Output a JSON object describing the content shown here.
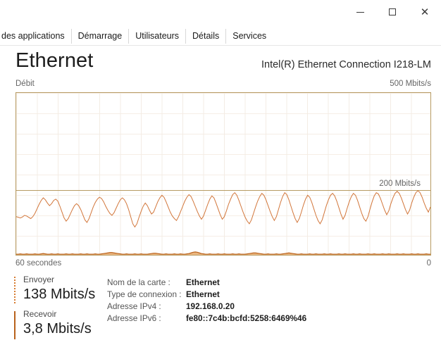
{
  "window": {
    "controls": [
      {
        "name": "minimize",
        "glyph": "minimize-icon"
      },
      {
        "name": "maximize",
        "glyph": "maximize-icon"
      },
      {
        "name": "close",
        "glyph": "close-icon",
        "label": "✕"
      }
    ]
  },
  "tabs": [
    {
      "label": "des applications",
      "clipped": true
    },
    {
      "label": "Démarrage",
      "clipped": false
    },
    {
      "label": "Utilisateurs",
      "clipped": false
    },
    {
      "label": "Détails",
      "clipped": false
    },
    {
      "label": "Services",
      "clipped": false
    }
  ],
  "header": {
    "title": "Ethernet",
    "adapter": "Intel(R) Ethernet Connection I218-LM"
  },
  "graph": {
    "caption": "Débit",
    "scale_max": "500 Mbits/s",
    "marker_label": "200 Mbits/s",
    "axis_left": "60 secondes",
    "axis_right": "0",
    "color_send": "#d2763a",
    "color_recv": "#b9621c",
    "color_border": "#b79b63"
  },
  "legend": {
    "send": {
      "label": "Envoyer",
      "value": "138 Mbits/s"
    },
    "recv": {
      "label": "Recevoir",
      "value": "3,8 Mbits/s"
    }
  },
  "details": [
    {
      "key": "Nom de la carte :",
      "value": "Ethernet"
    },
    {
      "key": "Type de connexion :",
      "value": "Ethernet"
    },
    {
      "key": "Adresse IPv4 :",
      "value": "192.168.0.20"
    },
    {
      "key": "Adresse IPv6 :",
      "value": "fe80::7c4b:bcfd:5258:6469%46"
    }
  ],
  "chart_data": {
    "type": "line",
    "title": "Débit",
    "xlabel": "",
    "ylabel": "Mbits/s",
    "ylim": [
      0,
      500
    ],
    "marker_value": 200,
    "xlim_label": [
      "60 secondes",
      "0"
    ],
    "grid": true,
    "legend": "left-panel",
    "series": [
      {
        "name": "Envoyer",
        "color": "#d2763a",
        "current": 138,
        "values": [
          118,
          116,
          114,
          117,
          122,
          120,
          116,
          112,
          118,
          128,
          142,
          156,
          168,
          176,
          170,
          160,
          152,
          158,
          168,
          172,
          166,
          150,
          132,
          114,
          104,
          112,
          126,
          140,
          152,
          158,
          152,
          140,
          124,
          108,
          100,
          112,
          130,
          148,
          162,
          172,
          178,
          174,
          164,
          150,
          138,
          128,
          122,
          130,
          144,
          158,
          170,
          176,
          170,
          158,
          140,
          118,
          96,
          86,
          96,
          116,
          134,
          150,
          160,
          152,
          138,
          126,
          132,
          148,
          164,
          176,
          184,
          178,
          164,
          148,
          132,
          120,
          112,
          106,
          118,
          134,
          150,
          166,
          178,
          186,
          180,
          166,
          150,
          134,
          120,
          110,
          120,
          138,
          156,
          172,
          182,
          176,
          160,
          142,
          124,
          110,
          118,
          136,
          156,
          172,
          186,
          192,
          184,
          168,
          150,
          132,
          116,
          104,
          96,
          108,
          128,
          148,
          166,
          180,
          190,
          184,
          170,
          152,
          134,
          118,
          106,
          118,
          140,
          162,
          180,
          192,
          186,
          170,
          150,
          130,
          112,
          100,
          112,
          132,
          154,
          172,
          184,
          178,
          162,
          142,
          122,
          106,
          96,
          108,
          130,
          152,
          170,
          184,
          190,
          182,
          166,
          146,
          126,
          110,
          122,
          144,
          164,
          180,
          190,
          184,
          168,
          148,
          128,
          112,
          104,
          118,
          142,
          164,
          182,
          192,
          188,
          174,
          156,
          138,
          124,
          136,
          158,
          176,
          190,
          196,
          190,
          176,
          158,
          140,
          126,
          138,
          160,
          178,
          192,
          198,
          192,
          178,
          160,
          144,
          132,
          148
        ]
      },
      {
        "name": "Recevoir",
        "color": "#b9621c",
        "current": 3.8,
        "values": [
          2,
          2,
          3,
          2,
          2,
          3,
          2,
          2,
          2,
          3,
          2,
          2,
          3,
          4,
          3,
          2,
          2,
          3,
          2,
          2,
          3,
          2,
          2,
          2,
          3,
          2,
          2,
          3,
          2,
          2,
          2,
          3,
          2,
          2,
          3,
          2,
          2,
          2,
          3,
          2,
          2,
          3,
          4,
          5,
          6,
          7,
          7,
          6,
          5,
          4,
          3,
          2,
          2,
          3,
          2,
          2,
          2,
          3,
          2,
          2,
          3,
          2,
          2,
          2,
          3,
          4,
          5,
          5,
          4,
          3,
          2,
          2,
          3,
          2,
          2,
          2,
          3,
          2,
          2,
          3,
          2,
          2,
          3,
          4,
          6,
          8,
          9,
          8,
          6,
          4,
          3,
          2,
          2,
          3,
          2,
          2,
          2,
          3,
          2,
          2,
          3,
          2,
          2,
          2,
          3,
          2,
          2,
          3,
          2,
          2,
          2,
          3,
          4,
          5,
          6,
          6,
          5,
          4,
          3,
          2,
          2,
          3,
          2,
          2,
          2,
          3,
          2,
          2,
          3,
          4,
          5,
          6,
          5,
          4,
          3,
          2,
          2,
          3,
          2,
          2,
          2,
          3,
          2,
          2,
          3,
          2,
          2,
          2,
          3,
          2,
          2,
          3,
          2,
          2,
          2,
          3,
          2,
          2,
          3,
          2,
          2,
          2,
          3,
          2,
          2,
          3,
          2,
          2,
          2,
          3,
          2,
          2,
          3,
          2,
          2,
          2,
          3,
          2,
          2,
          3,
          2,
          2,
          2,
          3,
          2,
          2,
          3,
          2,
          2,
          2,
          3,
          2,
          2,
          3,
          2,
          2,
          2,
          3,
          2,
          2
        ]
      }
    ]
  }
}
